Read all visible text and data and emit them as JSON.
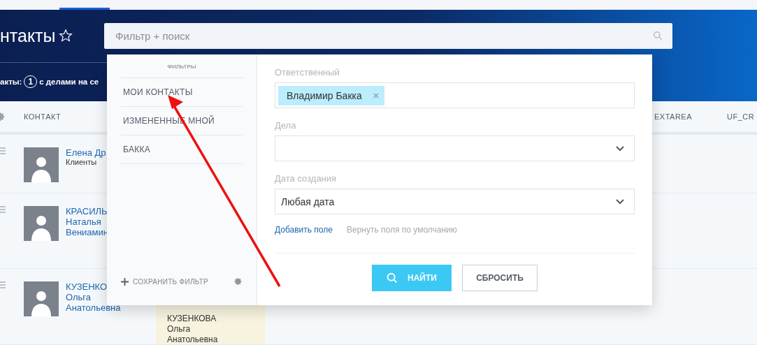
{
  "header": {
    "title": "нтакты",
    "search": {
      "placeholder": "Фильтр + поиск"
    },
    "counter": {
      "prefix": "акты:",
      "count": "1",
      "suffix": "с делами на се"
    }
  },
  "table": {
    "columns": [
      "КОНТАКТ",
      "EXTAREA",
      "UF_CR"
    ],
    "rows": [
      {
        "name_lines": [
          "Елена Др"
        ],
        "subtitle": "Клиенты"
      },
      {
        "name_lines": [
          "КРАСИЛЬ",
          "Наталья",
          "Вениамин"
        ]
      },
      {
        "name_lines": [
          "КУЗЕНКО",
          "Ольга",
          "Анатольевна"
        ],
        "column_2_lines": [
          "КУЗЕНКОВА",
          "Ольга",
          "Анатольевна"
        ]
      }
    ]
  },
  "filter_popup": {
    "heading": "ФИЛЬТРЫ",
    "presets": [
      {
        "label": "МОИ КОНТАКТЫ"
      },
      {
        "label": "ИЗМЕНЕННЫЕ МНОЙ"
      },
      {
        "label": "БАККА"
      }
    ],
    "save_label": "СОХРАНИТЬ ФИЛЬТР",
    "fields": [
      {
        "kind": "tags",
        "label": "Ответственный",
        "tags": [
          "Владимир Бакка"
        ]
      },
      {
        "kind": "select",
        "label": "Дела"
      },
      {
        "kind": "select",
        "label": "Дата создания",
        "value": "Любая дата"
      }
    ],
    "add_field": "Добавить поле",
    "restore_fields": "Вернуть поля по умолчанию",
    "find_button": "НАЙТИ",
    "reset_button": "СБРОСИТЬ"
  }
}
